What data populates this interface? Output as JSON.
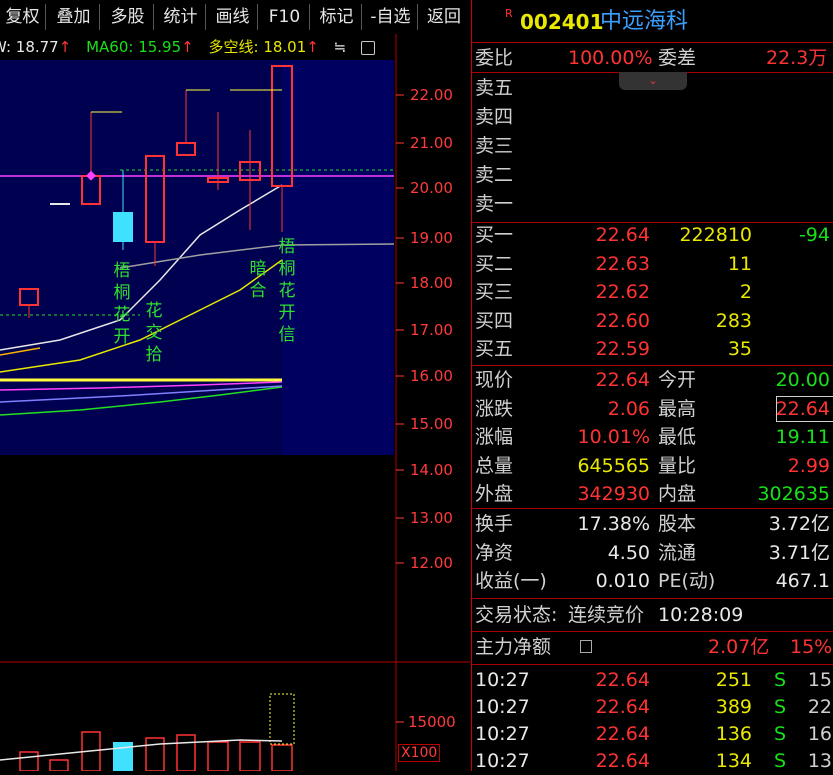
{
  "toolbar": {
    "buttons": [
      "复权",
      "叠加",
      "多股",
      "统计",
      "画线",
      "F10",
      "标记",
      "-自选",
      "返回"
    ]
  },
  "indicators": {
    "w_label": "W: 18.77",
    "ma60": "MA60: 15.95",
    "duokong": "多空线: 18.01",
    "arrow": "↑",
    "more": "≒"
  },
  "chart": {
    "y_ticks": [
      "22.00",
      "21.00",
      "20.00",
      "19.00",
      "18.00",
      "17.00",
      "16.00",
      "15.00",
      "14.00",
      "13.00",
      "12.00"
    ],
    "vol_tick": "15000",
    "vol_unit": "X100",
    "annotations": [
      {
        "text": "梧桐花开"
      },
      {
        "text": "花交拾"
      },
      {
        "text": "暗合"
      },
      {
        "text": "梧桐花开信"
      }
    ]
  },
  "quote": {
    "r_badge": "R",
    "code": "002401",
    "name": "中远海科",
    "weibi_label": "委比",
    "weibi_value": "100.00%",
    "weicha_label": "委差",
    "weicha_value": "22.3万",
    "sell": [
      {
        "label": "卖五"
      },
      {
        "label": "卖四"
      },
      {
        "label": "卖三"
      },
      {
        "label": "卖二"
      },
      {
        "label": "卖一"
      }
    ],
    "buy": [
      {
        "label": "买一",
        "price": "22.64",
        "vol": "222810",
        "chg": "-94"
      },
      {
        "label": "买二",
        "price": "22.63",
        "vol": "11",
        "chg": ""
      },
      {
        "label": "买三",
        "price": "22.62",
        "vol": "2",
        "chg": ""
      },
      {
        "label": "买四",
        "price": "22.60",
        "vol": "283",
        "chg": ""
      },
      {
        "label": "买五",
        "price": "22.59",
        "vol": "35",
        "chg": ""
      }
    ],
    "stats": [
      {
        "l1": "现价",
        "v1": "22.64",
        "l2": "今开",
        "v2": "20.00"
      },
      {
        "l1": "涨跌",
        "v1": "2.06",
        "l2": "最高",
        "v2": "22.64"
      },
      {
        "l1": "涨幅",
        "v1": "10.01%",
        "l2": "最低",
        "v2": "19.11"
      },
      {
        "l1": "总量",
        "v1": "645565",
        "l2": "量比",
        "v2": "2.99"
      },
      {
        "l1": "外盘",
        "v1": "342930",
        "l2": "内盘",
        "v2": "302635"
      }
    ],
    "stats2": [
      {
        "l1": "换手",
        "v1": "17.38%",
        "l2": "股本",
        "v2": "3.72亿"
      },
      {
        "l1": "净资",
        "v1": "4.50",
        "l2": "流通",
        "v2": "3.71亿"
      },
      {
        "l1": "收益(一)",
        "v1": "0.010",
        "l2": "PE(动)",
        "v2": "467.1"
      }
    ],
    "trade_status_label": "交易状态:",
    "trade_status_value": "连续竞价",
    "trade_time": "10:28:09",
    "main_flow_label": "主力净额",
    "main_flow_value": "2.07亿",
    "main_flow_pct": "15%",
    "ticks": [
      {
        "time": "10:27",
        "price": "22.64",
        "vol": "251",
        "side": "S",
        "num": "15"
      },
      {
        "time": "10:27",
        "price": "22.64",
        "vol": "389",
        "side": "S",
        "num": "22"
      },
      {
        "time": "10:27",
        "price": "22.64",
        "vol": "136",
        "side": "S",
        "num": "16"
      },
      {
        "time": "10:27",
        "price": "22.64",
        "vol": "134",
        "side": "S",
        "num": "13"
      }
    ]
  },
  "colors": {
    "up": "#ff3333",
    "down": "#18e018",
    "accent": "#e8e800",
    "chart_bg": "#000050"
  }
}
